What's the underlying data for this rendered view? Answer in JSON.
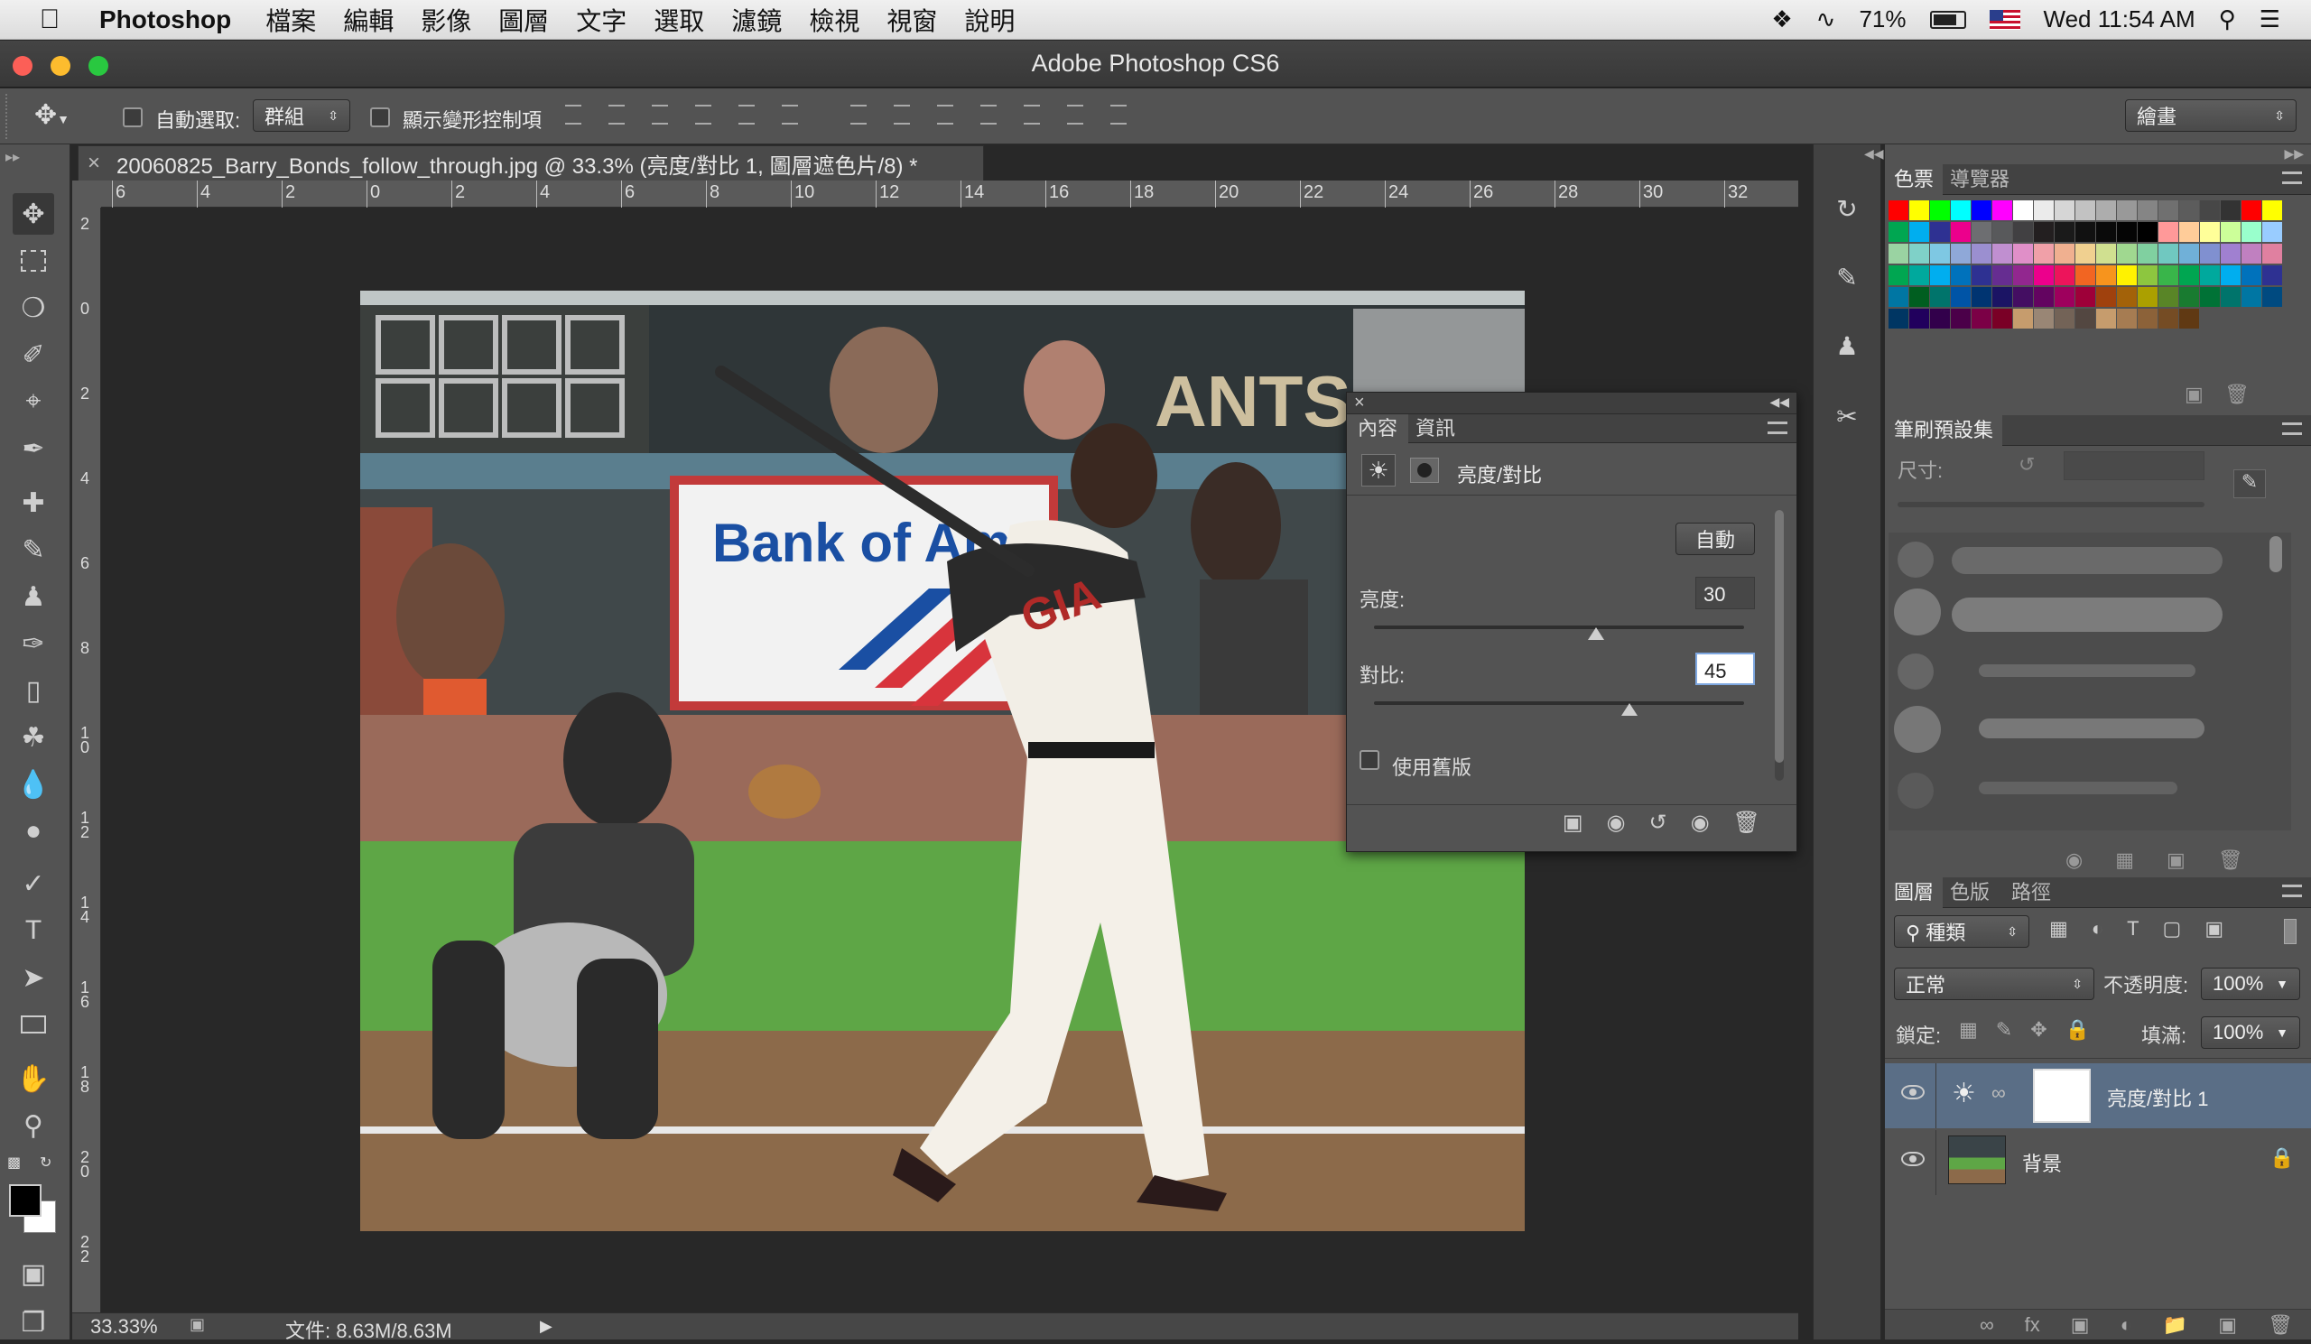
{
  "menubar": {
    "app_name": "Photoshop",
    "menus": [
      "檔案",
      "編輯",
      "影像",
      "圖層",
      "文字",
      "選取",
      "濾鏡",
      "檢視",
      "視窗",
      "說明"
    ],
    "battery": "71%",
    "clock": "Wed 11:54 AM"
  },
  "window": {
    "title": "Adobe Photoshop CS6"
  },
  "options": {
    "auto_select_label": "自動選取:",
    "auto_select_value": "群組",
    "show_transform_label": "顯示變形控制項",
    "workspace": "繪畫"
  },
  "document": {
    "tab_title": "20060825_Barry_Bonds_follow_through.jpg @ 33.3% (亮度/對比 1, 圖層遮色片/8) *",
    "ruler_h": [
      "6",
      "4",
      "2",
      "0",
      "2",
      "4",
      "6",
      "8",
      "10",
      "12",
      "14",
      "16",
      "18",
      "20",
      "22",
      "24",
      "26",
      "28",
      "30",
      "32"
    ],
    "ruler_v": [
      "2",
      "0",
      "2",
      "4",
      "6",
      "8",
      "10",
      "12",
      "14",
      "16",
      "18",
      "20",
      "22"
    ],
    "zoom": "33.33%",
    "file_info": "文件: 8.63M/8.63M"
  },
  "properties": {
    "tabs": [
      "內容",
      "資訊"
    ],
    "header": "亮度/對比",
    "auto_button": "自動",
    "brightness_label": "亮度:",
    "brightness_value": "30",
    "brightness_level": 0.6,
    "contrast_label": "對比:",
    "contrast_value": "45",
    "contrast_level": 0.69,
    "legacy_label": "使用舊版"
  },
  "swatches_panel": {
    "tabs": [
      "色票",
      "導覽器"
    ]
  },
  "brush_panel": {
    "title": "筆刷預設集",
    "size_label": "尺寸:"
  },
  "layers_panel": {
    "tabs": [
      "圖層",
      "色版",
      "路徑"
    ],
    "filter_kind": "種類",
    "blend_mode": "正常",
    "opacity_label": "不透明度:",
    "opacity_value": "100%",
    "lock_label": "鎖定:",
    "fill_label": "填滿:",
    "fill_value": "100%",
    "layers": [
      {
        "name": "亮度/對比 1"
      },
      {
        "name": "背景"
      }
    ]
  },
  "colors": {
    "swatch_rows": [
      [
        "#ff0000",
        "#ffff00",
        "#00ff00",
        "#00ffff",
        "#0000ff",
        "#ff00ff",
        "#ffffff",
        "#ebebeb",
        "#d6d6d6",
        "#c2c2c2",
        "#adadad",
        "#999999",
        "#858585",
        "#707070",
        "#5c5c5c",
        "#474747",
        "#333333",
        "#ff0000",
        "#ffff00"
      ],
      [
        "#00a651",
        "#00aeef",
        "#2e3192",
        "#ec008c",
        "#6d6e71",
        "#58595b",
        "#414042",
        "#231f20",
        "#1a1a1a",
        "#111111",
        "#0a0a0a",
        "#050505",
        "#000000",
        "#ff9999",
        "#ffcc99",
        "#ffff99",
        "#ccff99",
        "#99ffcc",
        "#99ccff"
      ],
      [
        "#9ad3a2",
        "#7fd1c8",
        "#7ec8e3",
        "#8fa8d8",
        "#9b8fd0",
        "#c08fd0",
        "#e08fc8",
        "#f0a0a8",
        "#f0b090",
        "#f0d090",
        "#d0e090",
        "#a0d890",
        "#80d0a0",
        "#70c8c0",
        "#70b0d8",
        "#8090d0",
        "#a080d0",
        "#c080c0",
        "#e080a0"
      ],
      [
        "#00a651",
        "#00a99d",
        "#00aeef",
        "#0072bc",
        "#2e3192",
        "#662d91",
        "#92278f",
        "#ec008c",
        "#ed145b",
        "#f26522",
        "#f7941d",
        "#fff200",
        "#8dc63f",
        "#39b54a",
        "#00a651",
        "#00a99d",
        "#00aeef",
        "#0072bc",
        "#2e3192"
      ],
      [
        "#0076a3",
        "#005e20",
        "#00746b",
        "#0054a6",
        "#003471",
        "#1b1464",
        "#440e62",
        "#630460",
        "#9e005d",
        "#9e0039",
        "#a0410d",
        "#a36209",
        "#aba000",
        "#598527",
        "#197b30",
        "#007236",
        "#00746b",
        "#0076a3",
        "#004a80"
      ],
      [
        "#003663",
        "#21005d",
        "#32004b",
        "#4b0049",
        "#7b0046",
        "#7a0026",
        "#c69c6d",
        "#998675",
        "#736357",
        "#534741",
        "#c69c6d",
        "#a67c52",
        "#8c6239",
        "#754c24",
        "#603913"
      ]
    ]
  }
}
